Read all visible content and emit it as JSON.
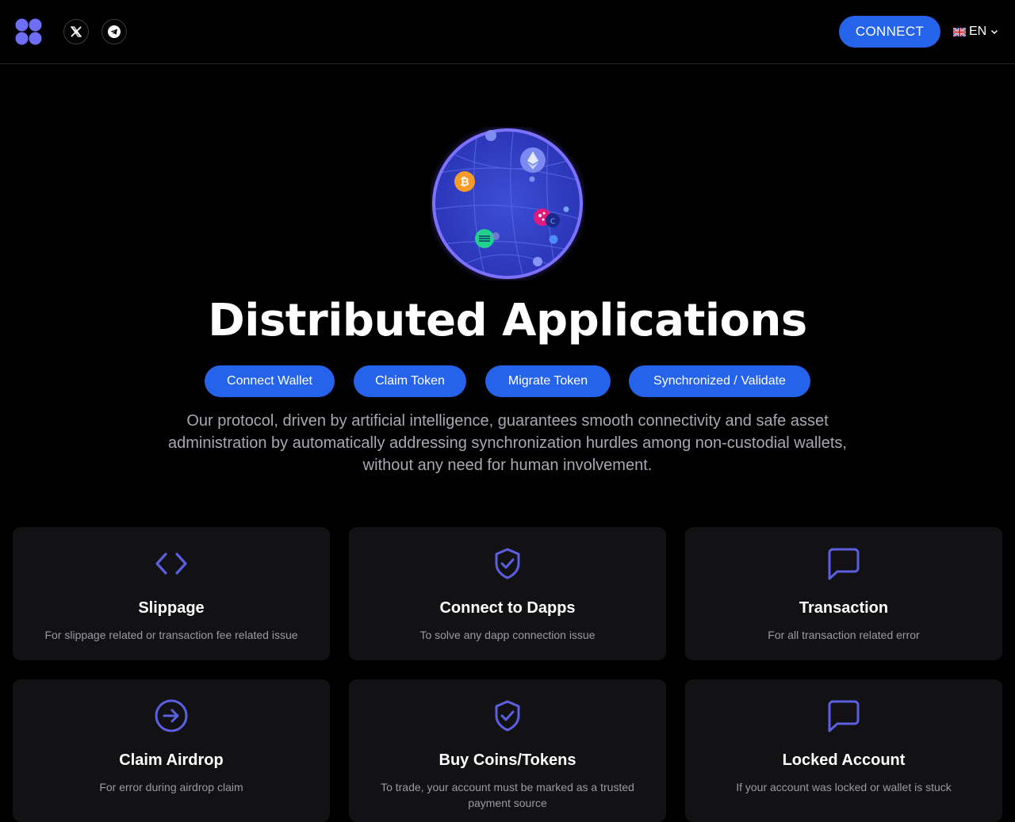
{
  "header": {
    "connect_label": "CONNECT",
    "language": "EN",
    "social": [
      "x-icon",
      "telegram-icon"
    ]
  },
  "hero": {
    "title": "Distributed Applications",
    "actions": [
      "Connect Wallet",
      "Claim Token",
      "Migrate Token",
      "Synchronized / Validate"
    ],
    "description": "Our protocol, driven by artificial intelligence, guarantees smooth connectivity and safe asset administration by automatically addressing synchronization hurdles among non-custodial wallets, without any need for human involvement."
  },
  "cards": [
    {
      "icon": "code-icon",
      "title": "Slippage",
      "subtitle": "For slippage related or transaction fee related issue"
    },
    {
      "icon": "shield-check-icon",
      "title": "Connect to Dapps",
      "subtitle": "To solve any dapp connection issue"
    },
    {
      "icon": "message-icon",
      "title": "Transaction",
      "subtitle": "For all transaction related error"
    },
    {
      "icon": "arrow-right-circle-icon",
      "title": "Claim Airdrop",
      "subtitle": "For error during airdrop claim"
    },
    {
      "icon": "shield-check-icon",
      "title": "Buy Coins/Tokens",
      "subtitle": "To trade, your account must be marked as a trusted payment source"
    },
    {
      "icon": "message-icon",
      "title": "Locked Account",
      "subtitle": "If your account was locked or wallet is stuck"
    }
  ],
  "colors": {
    "background": "#000000",
    "accent": "#2563eb",
    "icon": "#5b5fe0",
    "card": "#121214",
    "muted_text": "#a8a8b3"
  }
}
